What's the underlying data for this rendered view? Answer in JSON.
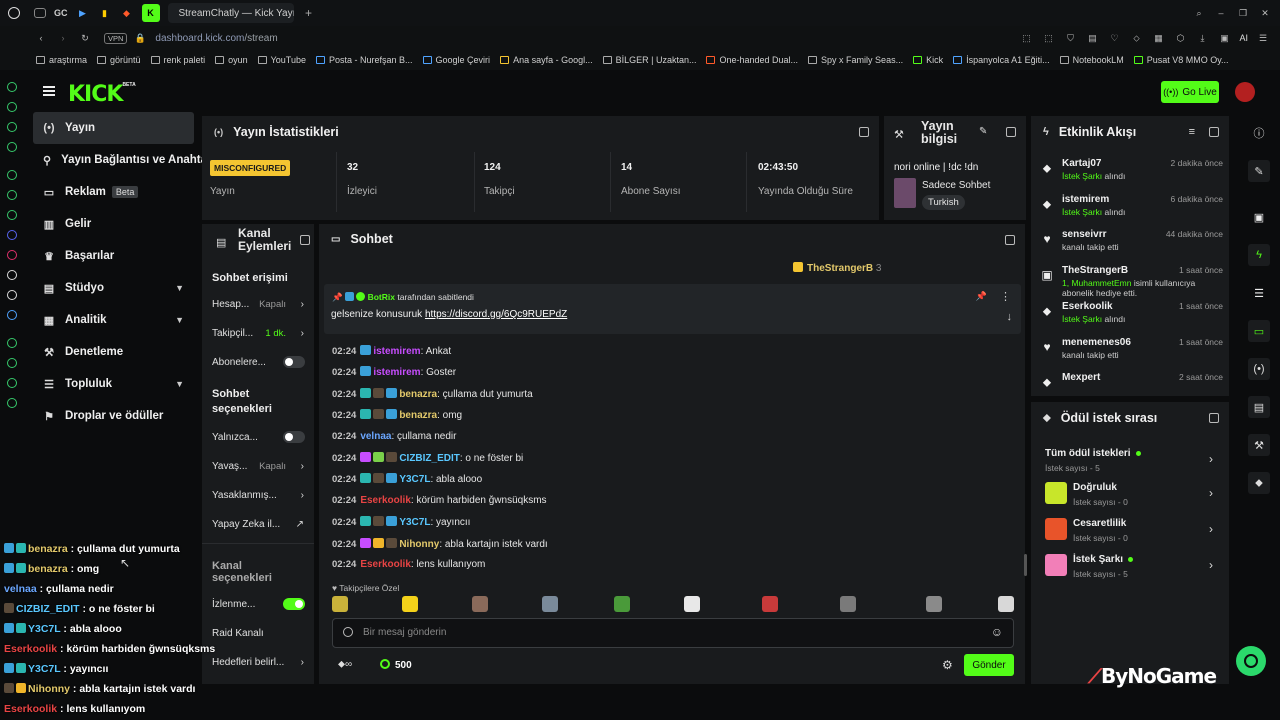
{
  "browser": {
    "tab_title": "StreamChatly — Kick Yayını",
    "tab_icons": [
      "GC"
    ],
    "url_domain": "dashboard.kick.com",
    "url_path": "/stream",
    "vpn_label": "VPN",
    "ai_label": "AI",
    "bookmarks": [
      "araştırma",
      "görüntü",
      "renk paleti",
      "oyun",
      "YouTube",
      "Posta - Nurefşan B...",
      "Google Çeviri",
      "Ana sayfa - Googl...",
      "BİLGER | Uzaktan...",
      "One-handed Dual...",
      "Spy x Family Seas...",
      "Kick",
      "İspanyolca A1 Eğiti...",
      "NotebookLM",
      "Pusat V8 MMO Oy..."
    ]
  },
  "header": {
    "logo": "KICK",
    "logo_sup": "BETA",
    "go_live": "Go Live"
  },
  "nav": {
    "items": [
      {
        "label": "Yayın",
        "icon": "(•)"
      },
      {
        "label": "Yayın Bağlantısı ve Anahtarı",
        "icon": "⚲"
      },
      {
        "label": "Reklam",
        "icon": "▭",
        "badge": "Beta"
      },
      {
        "label": "Gelir",
        "icon": "▥"
      },
      {
        "label": "Başarılar",
        "icon": "♛"
      },
      {
        "label": "Stüdyo",
        "icon": "▤"
      },
      {
        "label": "Analitik",
        "icon": "▦"
      },
      {
        "label": "Denetleme",
        "icon": "⚒"
      },
      {
        "label": "Topluluk",
        "icon": "☰"
      },
      {
        "label": "Droplar ve ödüller",
        "icon": "⚑"
      }
    ]
  },
  "stats": {
    "title": "Yayın İstatistikleri",
    "status_badge": "MISCONFIGURED",
    "status_label": "Yayın",
    "cells": [
      {
        "value": "32",
        "label": "İzleyici"
      },
      {
        "value": "124",
        "label": "Takipçi"
      },
      {
        "value": "14",
        "label": "Abone Sayısı"
      },
      {
        "value": "02:43:50",
        "label": "Yayında Olduğu Süre"
      }
    ]
  },
  "info": {
    "title_line1": "Yayın",
    "title_line2": "bilgisi",
    "stream_title": "nori online | !dc !dn",
    "category": "Sadece Sohbet",
    "language": "Turkish"
  },
  "activity": {
    "title": "Etkinlik Akışı",
    "items": [
      {
        "name": "Kartaj07",
        "time": "2 dakika önce",
        "highlight": "İstek Şarkı",
        "text": " alındı",
        "icon": "⬥"
      },
      {
        "name": "istemirem",
        "time": "6 dakika önce",
        "highlight": "İstek Şarkı",
        "text": " alındı",
        "icon": "⬥"
      },
      {
        "name": "senseivrr",
        "time": "44 dakika önce",
        "highlight": "",
        "text": "kanalı takip etti",
        "icon": "♥"
      },
      {
        "name": "TheStrangerB",
        "time": "1 saat önce",
        "highlight": "1, MuhammetEmn",
        "text": " isimli kullanıcıya abonelik hediye etti.",
        "icon": "▣"
      },
      {
        "name": "Eserkoolik",
        "time": "1 saat önce",
        "highlight": "İstek Şarkı",
        "text": " alındı",
        "icon": "⬥"
      },
      {
        "name": "menemenes06",
        "time": "1 saat önce",
        "highlight": "",
        "text": "kanalı takip etti",
        "icon": "♥"
      },
      {
        "name": "Mexpert",
        "time": "2 saat önce",
        "highlight": "",
        "text": "",
        "icon": "⬥"
      }
    ]
  },
  "rewards": {
    "title": "Ödül istek sırası",
    "all_label": "Tüm ödül istekleri",
    "all_count": "İstek sayısı - 5",
    "items": [
      {
        "name": "Doğruluk",
        "count": "İstek sayısı - 0",
        "color": "#c8e62a",
        "dot": false
      },
      {
        "name": "Cesaretlilik",
        "count": "İstek sayısı - 0",
        "color": "#e8542a",
        "dot": false
      },
      {
        "name": "İstek Şarkı",
        "count": "İstek sayısı - 5",
        "color": "#f27fb8",
        "dot": true
      }
    ]
  },
  "kanal": {
    "title_line1": "Kanal",
    "title_line2": "Eylemleri",
    "section1": "Sohbet erişimi",
    "rows1": [
      {
        "label": "Hesap...",
        "value": "Kapalı",
        "type": "chevron",
        "green": false
      },
      {
        "label": "Takipçil...",
        "value": "1 dk.",
        "type": "chevron",
        "green": true
      },
      {
        "label": "Abonelere...",
        "value": "",
        "type": "toggle",
        "on": false
      }
    ],
    "section2_line1": "Sohbet",
    "section2_line2": "seçenekleri",
    "rows2": [
      {
        "label": "Yalnızca...",
        "value": "",
        "type": "toggle",
        "on": false
      },
      {
        "label": "Yavaş...",
        "value": "Kapalı",
        "type": "chevron"
      },
      {
        "label": "Yasaklanmış...",
        "value": "",
        "type": "chevron"
      },
      {
        "label": "Yapay Zeka il...",
        "value": "",
        "type": "external"
      }
    ],
    "section3": "Kanal seçenekleri",
    "rows3": [
      {
        "label": "İzlenme...",
        "value": "",
        "type": "toggle",
        "on": true
      },
      {
        "label": "Raid Kanalı",
        "value": "",
        "type": "none"
      },
      {
        "label": "Hedefleri belirl...",
        "value": "",
        "type": "chevron"
      }
    ]
  },
  "chat": {
    "title": "Sohbet",
    "top_gifter": "TheStrangerB",
    "top_gifter_count": "3",
    "pinned_by": "BotRix",
    "pinned_suffix": "tarafından sabitlendi",
    "pinned_text": "gelsenize konusuruk ",
    "pinned_link": "https://discord.gg/6Qc9RUEPdZ",
    "messages": [
      {
        "time": "02:24",
        "user": "istemirem",
        "color": "#c74dff",
        "text": ": Ankat",
        "badges": [
          "#3aa0d8"
        ]
      },
      {
        "time": "02:24",
        "user": "istemirem",
        "color": "#c74dff",
        "text": ": Goster",
        "badges": [
          "#3aa0d8"
        ]
      },
      {
        "time": "02:24",
        "user": "benazra",
        "color": "#e3c96b",
        "text": ": çullama dut yumurta",
        "badges": [
          "#2bb6b0",
          "#5a4a3a",
          "#3aa0d8"
        ]
      },
      {
        "time": "02:24",
        "user": "benazra",
        "color": "#e3c96b",
        "text": ": omg",
        "badges": [
          "#2bb6b0",
          "#5a4a3a",
          "#3aa0d8"
        ]
      },
      {
        "time": "02:24",
        "user": "velnaa",
        "color": "#6ba7ff",
        "text": ": çullama nedir",
        "badges": []
      },
      {
        "time": "02:24",
        "user": "CIZBIZ_EDIT",
        "color": "#5ac8ff",
        "text": ": o ne föster bi",
        "badges": [
          "#c74dff",
          "#7ad04a",
          "#5a4a3a"
        ]
      },
      {
        "time": "02:24",
        "user": "Y3C7L",
        "color": "#5ac8ff",
        "text": ": abla alooo",
        "badges": [
          "#2bb6b0",
          "#5a4a3a",
          "#3aa0d8"
        ]
      },
      {
        "time": "02:24",
        "user": "Eserkoolik",
        "color": "#e84444",
        "text": ": körüm harbiden ğwnsüqksms",
        "badges": []
      },
      {
        "time": "02:24",
        "user": "Y3C7L",
        "color": "#5ac8ff",
        "text": ": yayıncıı",
        "badges": [
          "#2bb6b0",
          "#5a4a3a",
          "#3aa0d8"
        ]
      },
      {
        "time": "02:24",
        "user": "Nihonny",
        "color": "#e3c96b",
        "text": ": abla kartaјın istek vardı",
        "badges": [
          "#c74dff",
          "#f0b52a",
          "#5a4a3a"
        ]
      },
      {
        "time": "02:24",
        "user": "Eserkoolik",
        "color": "#e84444",
        "text": ": lens kullanıyom",
        "badges": []
      }
    ],
    "emote_label": "Takipçilere Özel",
    "input_placeholder": "Bir mesaj gönderin",
    "points": "500",
    "send": "Gönder"
  },
  "overlay": {
    "lines": [
      {
        "user": "benazra",
        "color": "#e3c96b",
        "text": " : çullama dut yumurta",
        "badges": [
          "#3aa0d8",
          "#2bb6b0"
        ]
      },
      {
        "user": "benazra",
        "color": "#e3c96b",
        "text": " : omg",
        "badges": [
          "#3aa0d8",
          "#2bb6b0"
        ]
      },
      {
        "user": "velnaa",
        "color": "#6ba7ff",
        "text": " : çullama nedir",
        "badges": []
      },
      {
        "user": "CIZBIZ_EDIT",
        "color": "#5ac8ff",
        "text": " : o ne föster bi",
        "badges": [
          "#5a4a3a"
        ]
      },
      {
        "user": "Y3C7L",
        "color": "#5ac8ff",
        "text": " : abla alooo",
        "badges": [
          "#3aa0d8",
          "#2bb6b0"
        ]
      },
      {
        "user": "Eserkoolik",
        "color": "#e84444",
        "text": " : körüm harbiden ğwnsüqksms",
        "badges": []
      },
      {
        "user": "Y3C7L",
        "color": "#5ac8ff",
        "text": " : yayıncıı",
        "badges": [
          "#3aa0d8",
          "#2bb6b0"
        ]
      },
      {
        "user": "Nihonny",
        "color": "#e3c96b",
        "text": " : abla kartaјın istek vardı",
        "badges": [
          "#5a4a3a",
          "#f0b52a"
        ]
      },
      {
        "user": "Eserkoolik",
        "color": "#e84444",
        "text": " : lens kullanıyom",
        "badges": []
      }
    ]
  },
  "watermark": "ByNoGame",
  "colors": {
    "accent": "#53fc18",
    "panel": "#191b1d",
    "bg": "#0b0c0d"
  }
}
